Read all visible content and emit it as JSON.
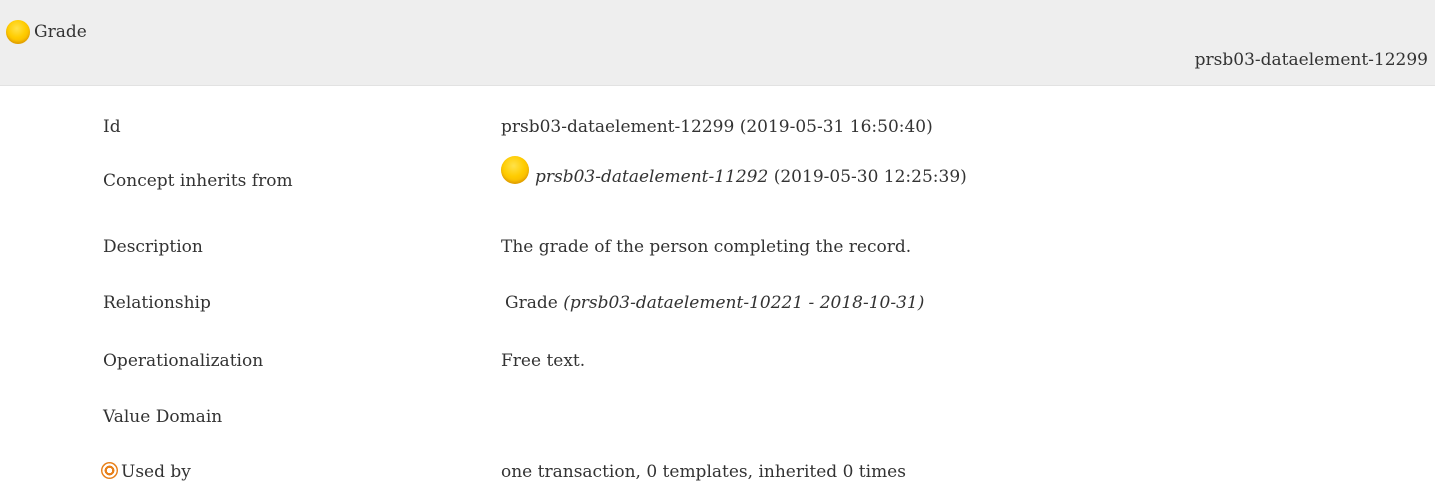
{
  "header": {
    "title": "Grade",
    "id": "prsb03-dataelement-12299",
    "icon": "yellow-circle-icon"
  },
  "rows": {
    "id": {
      "label": "Id",
      "value": "prsb03-dataelement-12299 (2019-05-31 16:50:40)"
    },
    "inherits": {
      "label": "Concept inherits from",
      "ref": "prsb03-dataelement-11292",
      "date": "(2019-05-30 12:25:39)",
      "icon": "yellow-circle-icon"
    },
    "description": {
      "label": "Description",
      "value": "The grade of the person completing the record."
    },
    "relationship": {
      "label": "Relationship",
      "name": "Grade",
      "ref": "(prsb03-dataelement-10221 - 2018-10-31)"
    },
    "operationalization": {
      "label": "Operationalization",
      "value": "Free text."
    },
    "value_domain": {
      "label": "Value Domain"
    },
    "used_by": {
      "label": "Used by",
      "value": "one transaction, 0 templates, inherited 0 times",
      "icon": "target-icon"
    }
  },
  "colors": {
    "header_bg": "#eeeeee",
    "text": "#333333",
    "circle_yellow": "#ffcc00",
    "target_orange": "#e8801a"
  }
}
